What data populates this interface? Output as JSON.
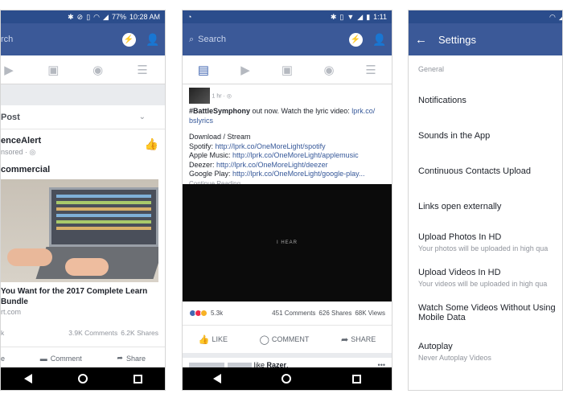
{
  "phone1": {
    "status_time": "10:28 AM",
    "status_battery": "77%",
    "search_label": "rch",
    "post_header": "Post",
    "author": "enceAlert",
    "sponsored": "nsored · ",
    "headline": "commercial",
    "link_title_1": "You Want for the 2017 Complete Learn",
    "link_title_2": "Bundle",
    "link_domain": "rt.com",
    "stats_left": "k",
    "comments": "3.9K Comments",
    "shares": "6.2K Shares",
    "action_left": "e",
    "action_comment": "Comment",
    "action_share": "Share"
  },
  "phone2": {
    "status_time": "1:11",
    "search_placeholder": "Search",
    "post_time": "1 hr · ",
    "hashtag": "#BattleSymphony",
    "post_line1_rest": " out now. Watch the lyric video: ",
    "link_lprk": "lprk.co/",
    "link_bslyrics": "bslyrics",
    "download_label": "Download / Stream",
    "spotify_label": "Spotify: ",
    "spotify_url": "http://lprk.co/OneMoreLight/spotify",
    "apple_label": "Apple Music: ",
    "apple_url": "http://lprk.co/OneMoreLight/applemusic",
    "deezer_label": "Deezer: ",
    "deezer_url": "http://lprk.co/OneMoreLight/deezer",
    "google_label": "Google Play: ",
    "google_url": "http://lprk.co/OneMoreLight/google-play...",
    "continue_reading": "Continue Reading",
    "video_caption": "I HEAR",
    "reaction_count": "5.3k",
    "comments": "451 Comments",
    "shares": "626 Shares",
    "views": "68K Views",
    "like_label": "LIKE",
    "comment_label": "COMMENT",
    "share_label": "SHARE",
    "next_post_tail": " like ",
    "next_post_bold": "Razer",
    "next_post_dot": "."
  },
  "phone3": {
    "title": "Settings",
    "section": "General",
    "items": [
      {
        "label": "Notifications",
        "sub": ""
      },
      {
        "label": "Sounds in the App",
        "sub": ""
      },
      {
        "label": "Continuous Contacts Upload",
        "sub": ""
      },
      {
        "label": "Links open externally",
        "sub": ""
      },
      {
        "label": "Upload Photos In HD",
        "sub": "Your photos will be uploaded in high qua"
      },
      {
        "label": "Upload Videos In HD",
        "sub": "Your videos will be uploaded in high qua"
      },
      {
        "label": "Watch Some Videos Without Using",
        "label2": "Mobile Data",
        "sub": ""
      },
      {
        "label": "Autoplay",
        "sub": "Never Autoplay Videos"
      }
    ]
  },
  "colors": {
    "facebook_blue": "#3b5998",
    "status_blue": "#2b4d8c",
    "link_blue": "#365899"
  }
}
